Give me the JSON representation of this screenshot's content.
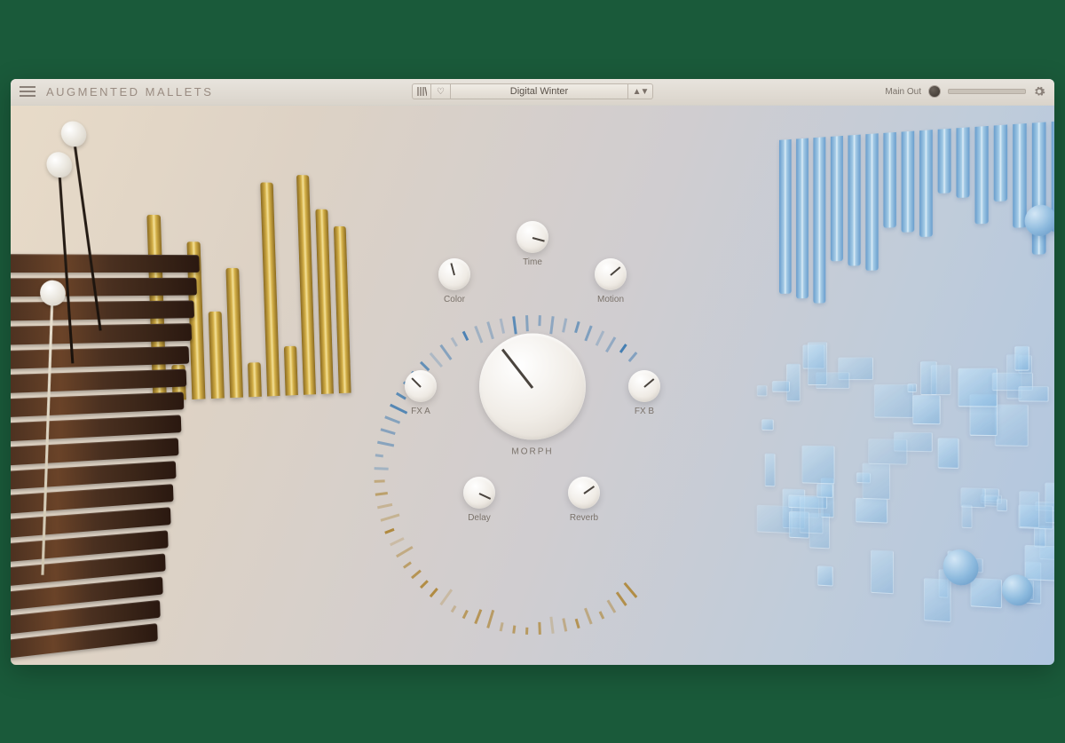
{
  "header": {
    "title": "AUGMENTED MALLETS",
    "preset_name": "Digital Winter",
    "main_out_label": "Main Out"
  },
  "knobs": {
    "morph": {
      "label": "MORPH",
      "angle": -128
    },
    "time": {
      "label": "Time",
      "angle": 15
    },
    "color": {
      "label": "Color",
      "angle": -105
    },
    "motion": {
      "label": "Motion",
      "angle": -40
    },
    "fxa": {
      "label": "FX A",
      "angle": -135
    },
    "fxb": {
      "label": "FX B",
      "angle": -40
    },
    "delay": {
      "label": "Delay",
      "angle": 25
    },
    "reverb": {
      "label": "Reverb",
      "angle": -35
    }
  },
  "colors": {
    "arc_left": "#b08a40",
    "arc_right": "#3a78b0"
  }
}
